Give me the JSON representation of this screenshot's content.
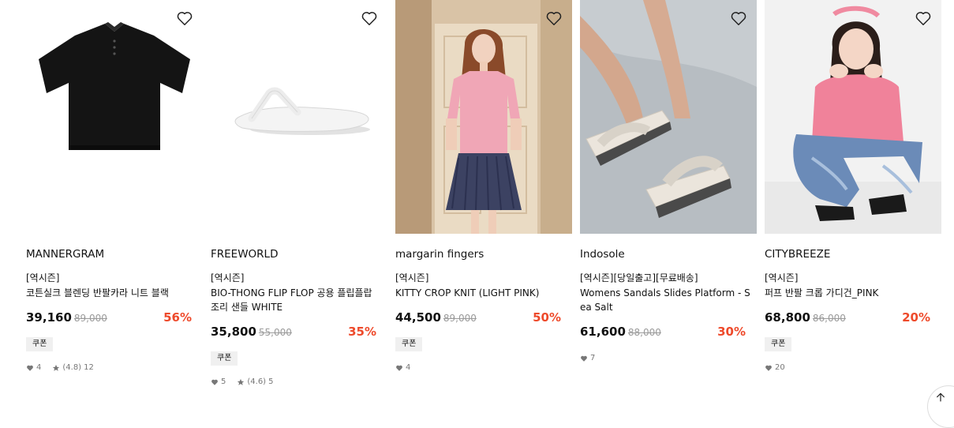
{
  "products": [
    {
      "brand": "MANNERGRAM",
      "tag": "[역시즌]",
      "title": "코튼실크 블렌딩 반팔카라 니트 블랙",
      "price": "39,160",
      "original_price": "89,000",
      "discount": "56%",
      "coupon": "쿠폰",
      "likes": "4",
      "rating": "(4.8)",
      "reviews": "12",
      "image": "black knit polo shirt"
    },
    {
      "brand": "FREEWORLD",
      "tag": "[역시즌]",
      "title": "BIO-THONG FLIP FLOP 공용 플립플랍 조리 샌들 WHITE",
      "price": "35,800",
      "original_price": "55,000",
      "discount": "35%",
      "coupon": "쿠폰",
      "likes": "5",
      "rating": "(4.6)",
      "reviews": "5",
      "image": "white flip flop"
    },
    {
      "brand": "margarin fingers",
      "tag": "[역시즌]",
      "title": "KITTY CROP KNIT (LIGHT PINK)",
      "price": "44,500",
      "original_price": "89,000",
      "discount": "50%",
      "coupon": "쿠폰",
      "likes": "4",
      "image": "model in pink knit and navy pleated skirt"
    },
    {
      "brand": "Indosole",
      "tag": "[역시즌][당일출고][무료배송]",
      "title": "Womens Sandals Slides Platform - Sea Salt",
      "price": "61,600",
      "original_price": "88,000",
      "discount": "30%",
      "likes": "7",
      "image": "platform slide sandals on feet"
    },
    {
      "brand": "CITYBREEZE",
      "tag": "[역시즌]",
      "title": "퍼프 반팔 크롭 가디건_PINK",
      "price": "68,800",
      "original_price": "86,000",
      "discount": "20%",
      "coupon": "쿠폰",
      "likes": "20",
      "image": "model crouching in pink cardigan and jeans"
    }
  ],
  "colors": {
    "discount": "#ee4a2b",
    "coupon_bg": "#f0f0f0",
    "meta": "#777777"
  }
}
